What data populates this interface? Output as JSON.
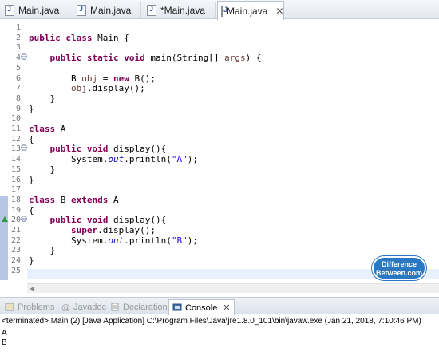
{
  "tabs": [
    {
      "label": "Main.java",
      "active": false
    },
    {
      "label": "Main.java",
      "active": false
    },
    {
      "label": "*Main.java",
      "active": false
    },
    {
      "label": "Main.java",
      "active": true
    }
  ],
  "tab_close_glyph": "✕",
  "editor": {
    "lines": [
      {
        "n": "1",
        "code": ""
      },
      {
        "n": "2",
        "code": "public class Main {"
      },
      {
        "n": "3",
        "code": ""
      },
      {
        "n": "4",
        "code": "    public static void main(String[] args) {"
      },
      {
        "n": "5",
        "code": ""
      },
      {
        "n": "6",
        "code": "        B obj = new B();"
      },
      {
        "n": "7",
        "code": "        obj.display();"
      },
      {
        "n": "8",
        "code": "    }"
      },
      {
        "n": "9",
        "code": "}"
      },
      {
        "n": "10",
        "code": ""
      },
      {
        "n": "11",
        "code": "class A"
      },
      {
        "n": "12",
        "code": "{"
      },
      {
        "n": "13",
        "code": "    public void display(){"
      },
      {
        "n": "14",
        "code": "        System.out.println(\"A\");"
      },
      {
        "n": "15",
        "code": "    }"
      },
      {
        "n": "16",
        "code": "}"
      },
      {
        "n": "17",
        "code": ""
      },
      {
        "n": "18",
        "code": "class B extends A"
      },
      {
        "n": "19",
        "code": "{"
      },
      {
        "n": "20",
        "code": "    public void display(){"
      },
      {
        "n": "21",
        "code": "        super.display();"
      },
      {
        "n": "22",
        "code": "        System.out.println(\"B\");"
      },
      {
        "n": "23",
        "code": "    }"
      },
      {
        "n": "24",
        "code": "}"
      },
      {
        "n": "25",
        "code": ""
      }
    ]
  },
  "watermark": {
    "line1": "Difference",
    "line2": "Between.com"
  },
  "views": [
    {
      "label": "Problems",
      "icon": "problems-icon",
      "active": false
    },
    {
      "label": "Javadoc",
      "icon": "javadoc-icon",
      "active": false
    },
    {
      "label": "Declaration",
      "icon": "declaration-icon",
      "active": false
    },
    {
      "label": "Console",
      "icon": "console-icon",
      "active": true
    }
  ],
  "view_close_glyph": "✕",
  "console": {
    "header": "<terminated> Main (2) [Java Application] C:\\Program Files\\Java\\jre1.8.0_101\\bin\\javaw.exe (Jan 21, 2018, 7:10:46 PM)",
    "output": [
      "A",
      "B"
    ]
  }
}
